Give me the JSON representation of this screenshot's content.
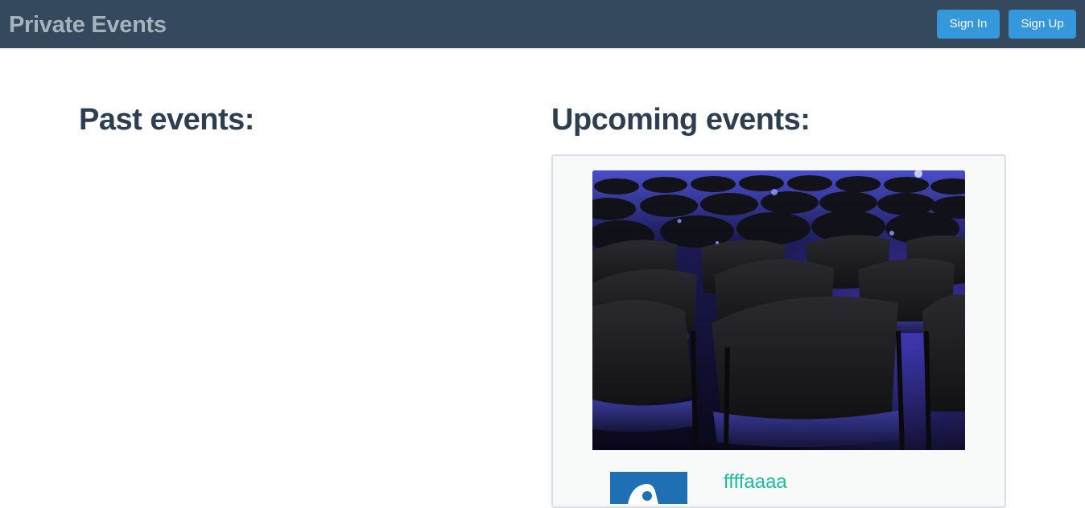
{
  "navbar": {
    "brand": "Private Events",
    "sign_in_label": "Sign In",
    "sign_up_label": "Sign Up",
    "background": "#34495e",
    "button_color": "#3498db"
  },
  "main": {
    "past_heading": "Past events:",
    "upcoming_heading": "Upcoming events:",
    "upcoming_events": [
      {
        "title": "ffffaaaa",
        "image_icon": "conference-seats-photo",
        "thumbnail_icon": "event-thumbnail"
      }
    ],
    "accent_color": "#1abc9c"
  }
}
